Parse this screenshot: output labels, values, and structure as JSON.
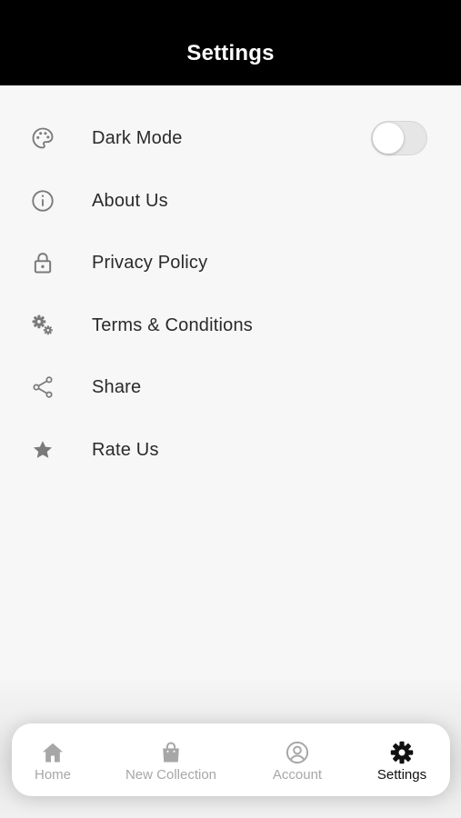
{
  "header": {
    "title": "Settings"
  },
  "settings": {
    "items": [
      {
        "label": "Dark Mode",
        "icon": "palette-icon",
        "control": "toggle",
        "toggle_on": false
      },
      {
        "label": "About Us",
        "icon": "info-icon"
      },
      {
        "label": "Privacy Policy",
        "icon": "lock-icon"
      },
      {
        "label": "Terms & Conditions",
        "icon": "gears-icon"
      },
      {
        "label": "Share",
        "icon": "share-icon"
      },
      {
        "label": "Rate Us",
        "icon": "star-icon"
      }
    ]
  },
  "tabbar": {
    "tabs": [
      {
        "label": "Home",
        "icon": "home-icon",
        "active": false
      },
      {
        "label": "New Collection",
        "icon": "shopping-bag-icon",
        "active": false
      },
      {
        "label": "Account",
        "icon": "account-icon",
        "active": false
      },
      {
        "label": "Settings",
        "icon": "gear-icon",
        "active": true
      }
    ]
  },
  "colors": {
    "header_bg": "#000000",
    "background": "#f7f7f7",
    "icon_gray": "#7a7a7a",
    "tab_inactive": "#a7a7a7",
    "tab_active": "#111111"
  }
}
